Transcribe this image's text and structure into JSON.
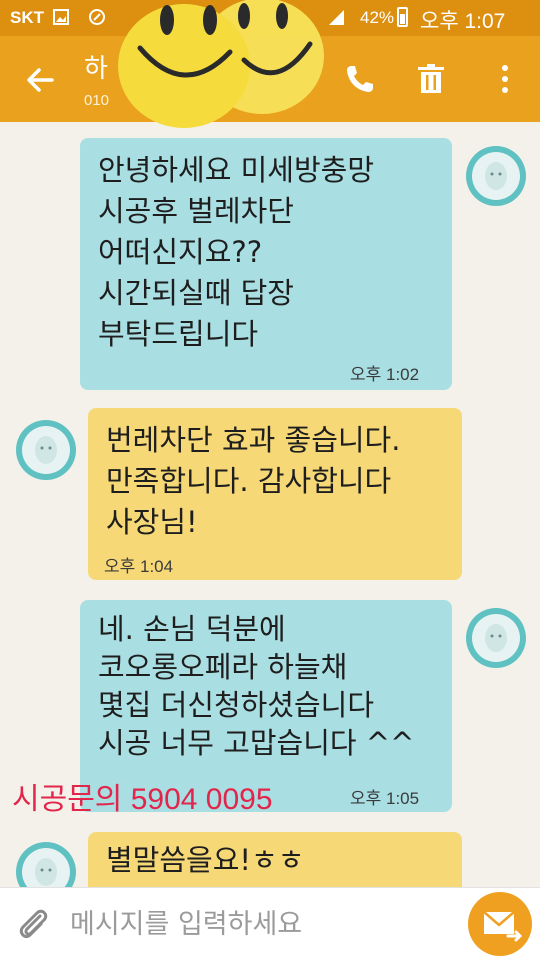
{
  "status_bar": {
    "carrier": "SKT",
    "battery": "42%",
    "time": "오후 1:07"
  },
  "header": {
    "contact_name": "하",
    "contact_number": "010"
  },
  "messages": [
    {
      "side": "out",
      "text": "안녕하세요  미세방충망\n시공후 벌레차단\n어떠신지요??\n시간되실때 답장\n부탁드립니다",
      "time": "오후 1:02"
    },
    {
      "side": "in",
      "text": "번레차단 효과 좋습니다.\n만족합니다.  감사합니다\n사장님!",
      "time": "오후 1:04"
    },
    {
      "side": "out",
      "text": "네. 손님 덕분에\n코오롱오페라 하늘채\n몇집 더신청하셨습니다\n시공 너무 고맙습니다 ^^",
      "time": "오후 1:05"
    },
    {
      "side": "in",
      "text": "별말씀을요!ㅎㅎ"
    }
  ],
  "promo": "시공문의 5904 0095",
  "input": {
    "placeholder": "메시지를 입력하세요"
  },
  "colors": {
    "header": "#e9a11e",
    "status_bar": "#dd8f10",
    "outgoing": "#a9dee3",
    "incoming": "#f6d877",
    "promo": "#e2254a",
    "send": "#f0a020"
  },
  "icons": [
    "back-arrow-icon",
    "phone-icon",
    "trash-icon",
    "more-vert-icon",
    "paperclip-icon",
    "envelope-send-icon",
    "avatar-icon",
    "smiley-sticker"
  ]
}
